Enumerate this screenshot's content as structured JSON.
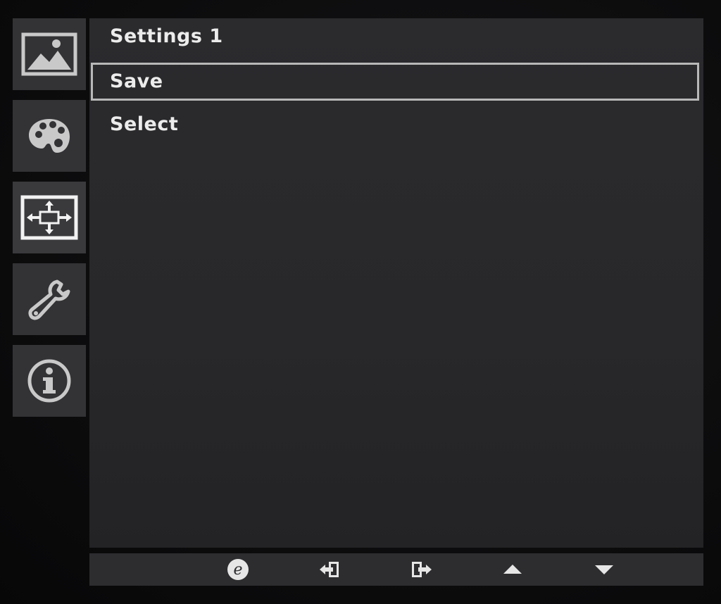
{
  "sidebar": {
    "items": [
      {
        "icon": "picture-icon"
      },
      {
        "icon": "color-palette-icon"
      },
      {
        "icon": "display-layout-icon",
        "active": true
      },
      {
        "icon": "wrench-icon"
      },
      {
        "icon": "info-icon"
      }
    ]
  },
  "main": {
    "title": "Settings 1",
    "items": [
      {
        "label": "Save",
        "selected": true
      },
      {
        "label": "Select",
        "selected": false
      }
    ]
  },
  "bottombar": {
    "buttons": [
      {
        "icon": "e-key-icon",
        "glyph": "e"
      },
      {
        "icon": "enter-icon"
      },
      {
        "icon": "exit-icon"
      },
      {
        "icon": "up-arrow-icon"
      },
      {
        "icon": "down-arrow-icon"
      }
    ]
  },
  "colors": {
    "text": "#ececec",
    "panel": "#2b2b2e",
    "tile": "#333336",
    "selection_border": "#b8b8b8",
    "icon": "#c9c9c9"
  }
}
